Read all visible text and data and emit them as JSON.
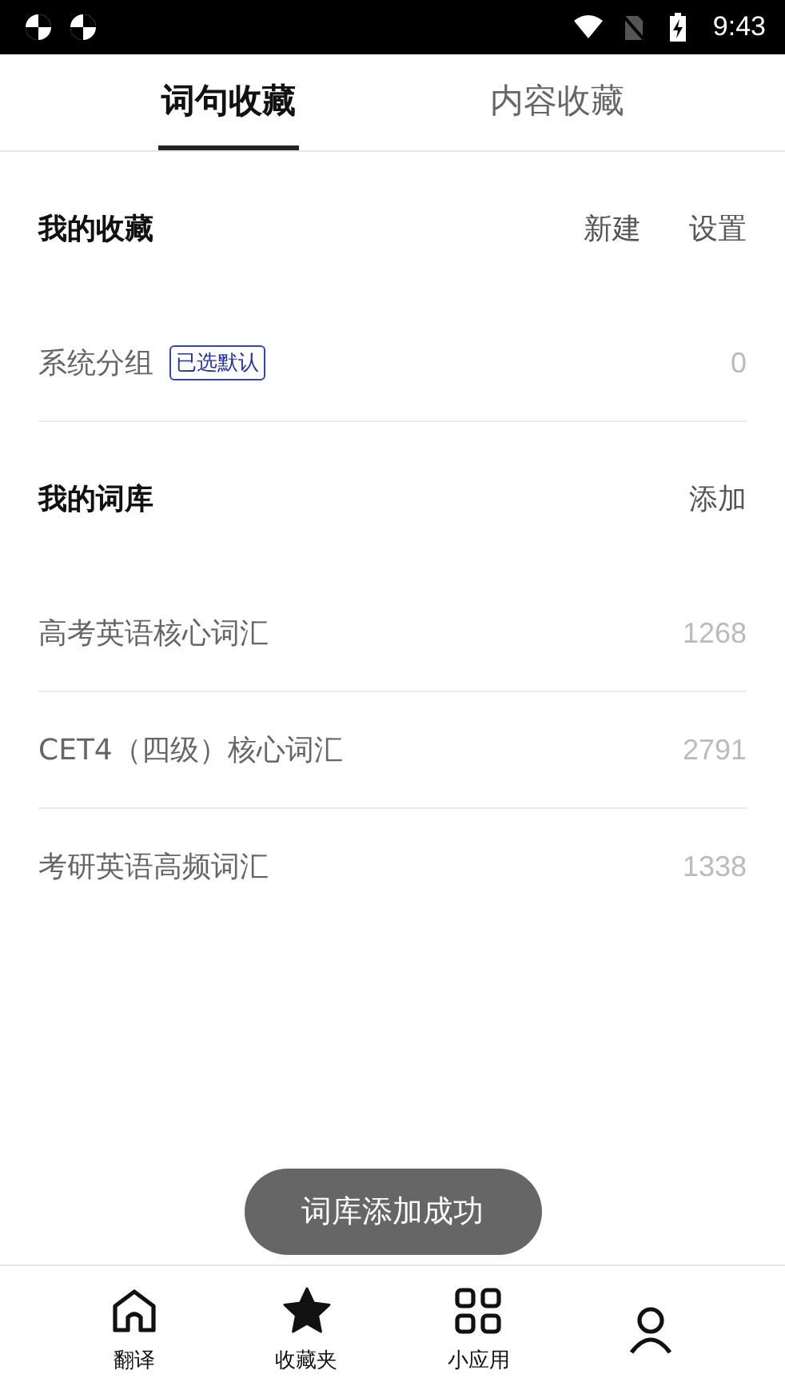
{
  "status_bar": {
    "time": "9:43"
  },
  "tabs": [
    {
      "label": "词句收藏",
      "selected": true
    },
    {
      "label": "内容收藏",
      "selected": false
    }
  ],
  "favorites": {
    "title": "我的收藏",
    "actions": [
      "新建",
      "设置"
    ],
    "rows": [
      {
        "name": "系统分组",
        "badge": "已选默认",
        "count": "0"
      }
    ]
  },
  "wordbanks": {
    "title": "我的词库",
    "actions": [
      "添加"
    ],
    "rows": [
      {
        "name": "高考英语核心词汇",
        "count": "1268"
      },
      {
        "name": "CET4（四级）核心词汇",
        "count": "2791"
      },
      {
        "name": "考研英语高频词汇",
        "count": "1338"
      }
    ]
  },
  "toast": "词库添加成功",
  "nav": [
    {
      "kind": "home",
      "label": "翻译"
    },
    {
      "kind": "star",
      "label": "收藏夹"
    },
    {
      "kind": "apps",
      "label": "小应用"
    },
    {
      "kind": "person"
    }
  ]
}
